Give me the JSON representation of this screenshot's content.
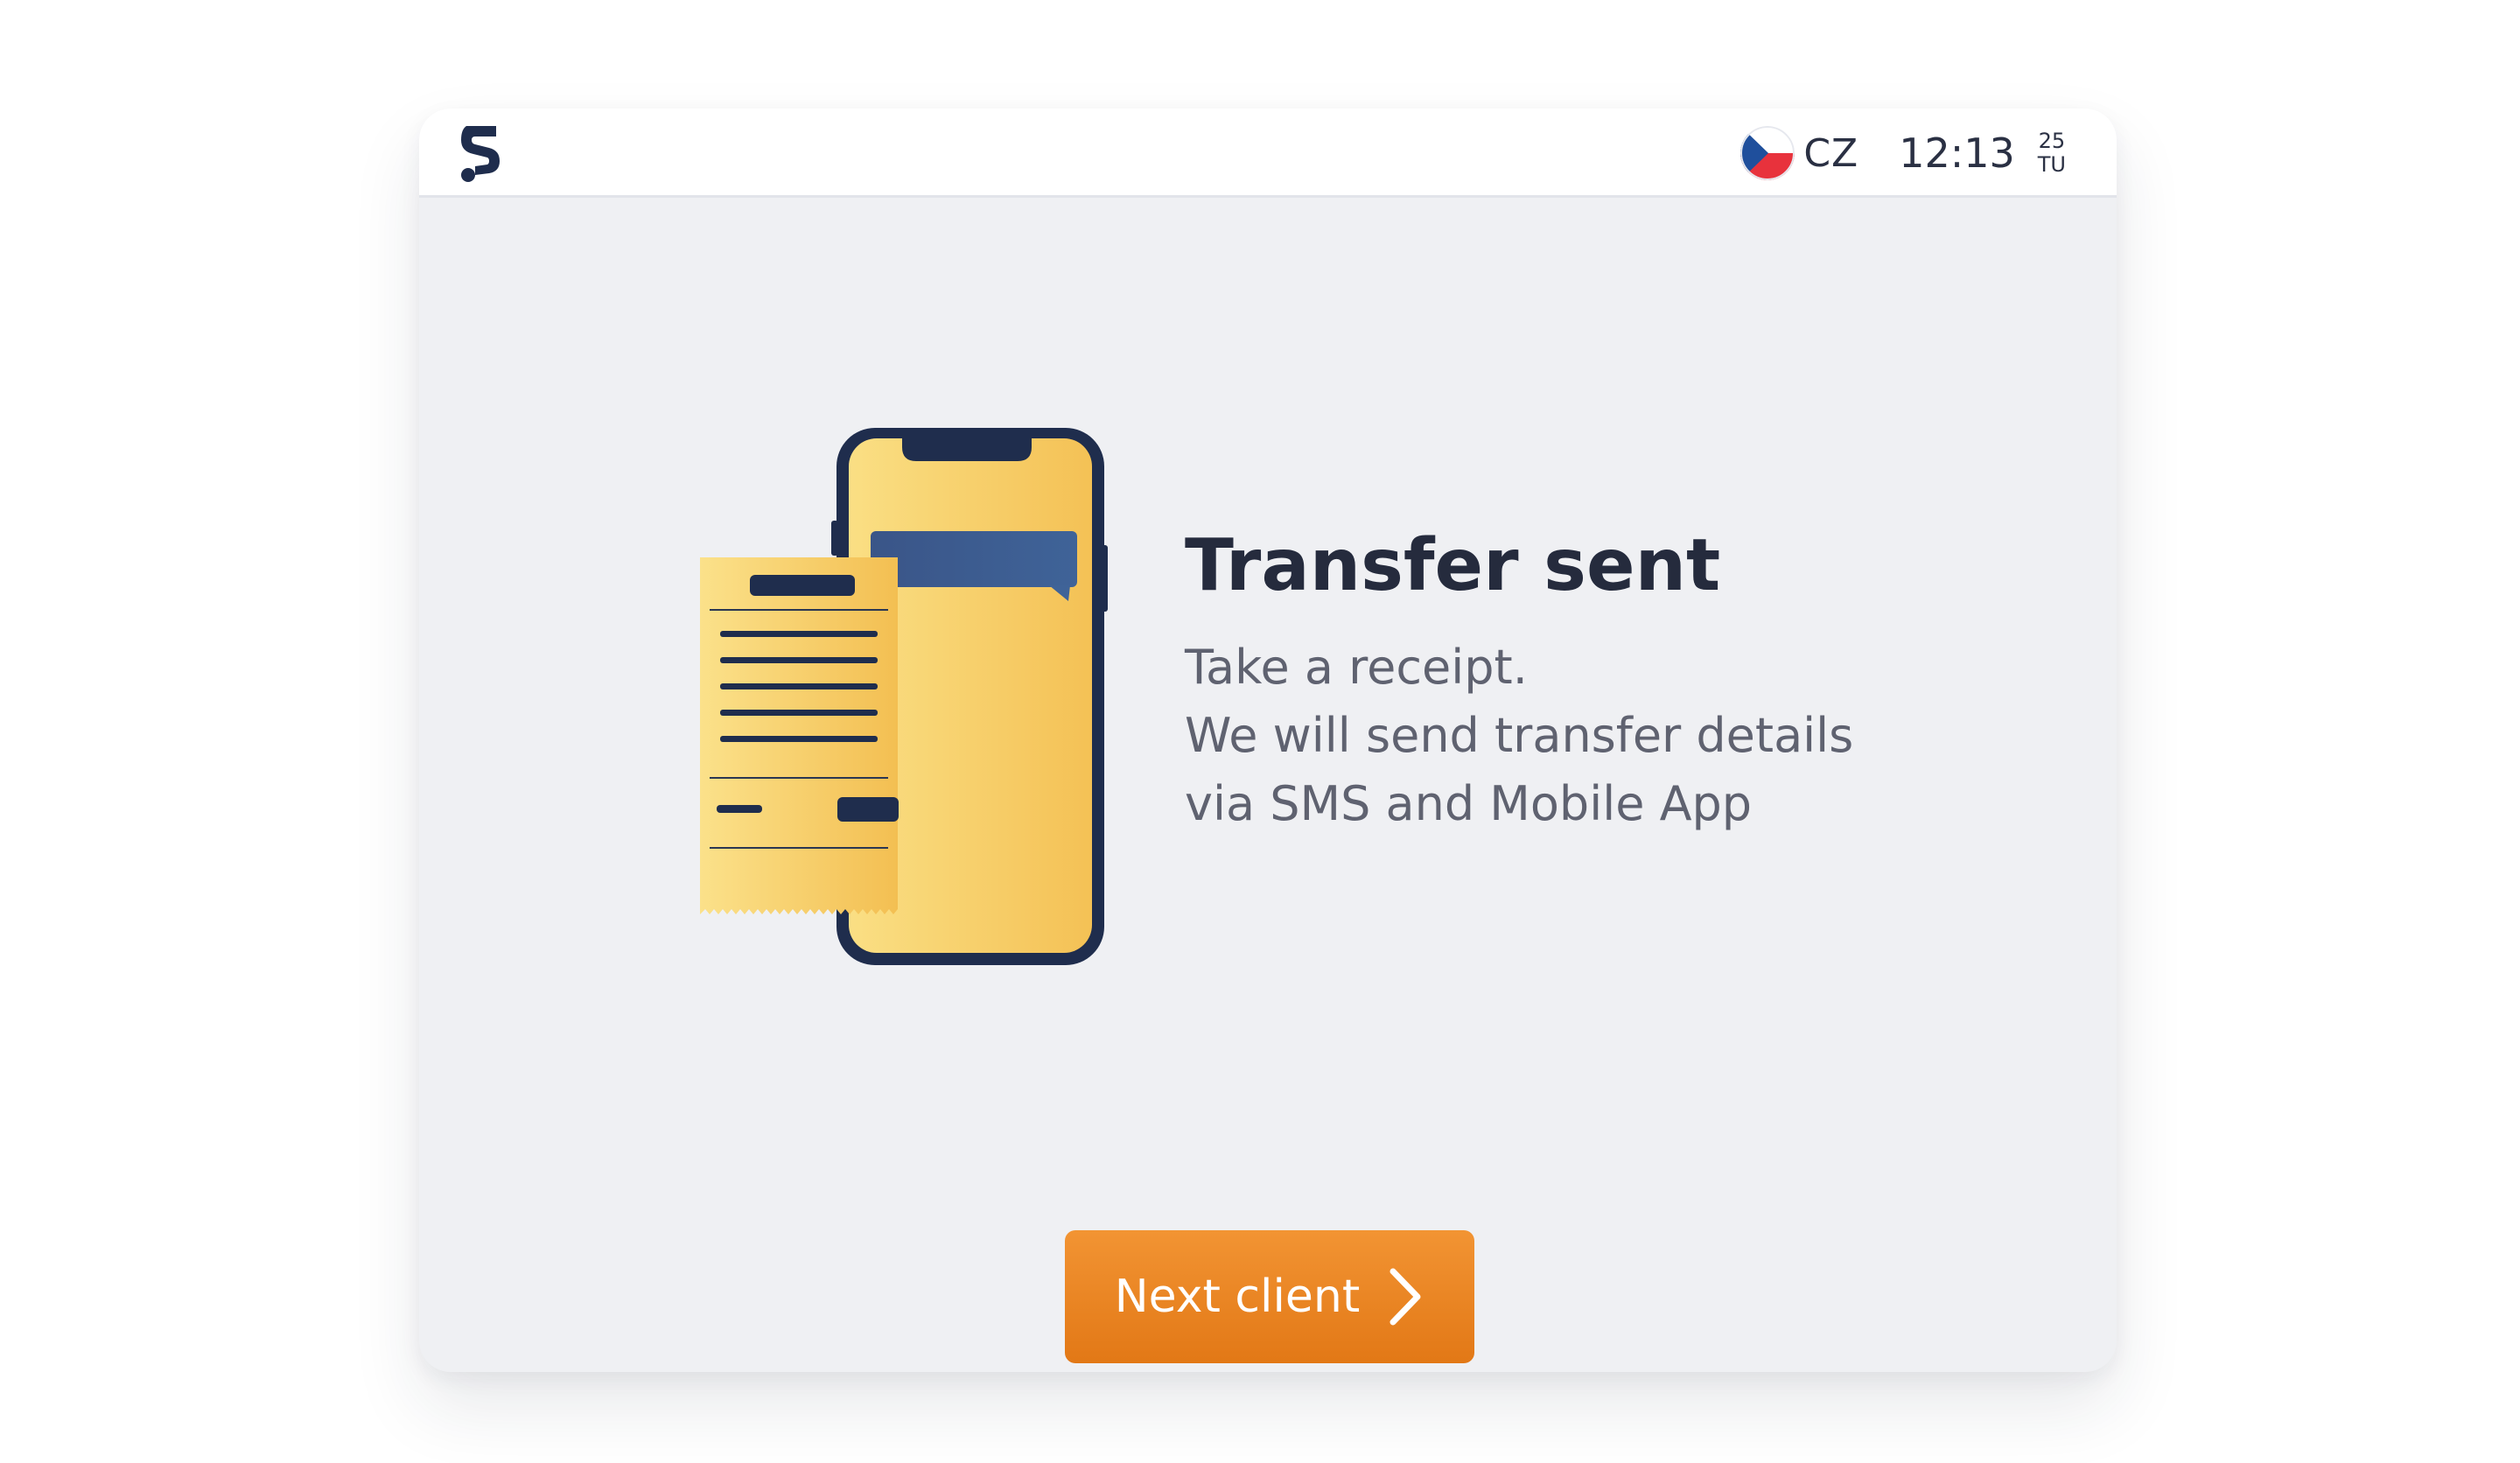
{
  "header": {
    "language": "CZ",
    "time": "12:13",
    "date_day": "25",
    "date_weekday": "TU"
  },
  "main": {
    "title": "Transfer sent",
    "message_lines": [
      "Take a receipt.",
      "We will send transfer details",
      "via SMS and Mobile App"
    ]
  },
  "footer": {
    "next_label": "Next client"
  },
  "icons": {
    "logo": "brand-s-logo",
    "flag": "czech-flag",
    "illustration": "phone-with-receipt",
    "next": "chevron-right"
  },
  "colors": {
    "brand_navy": "#1f2d4d",
    "accent_orange": "#ee8a27",
    "background": "#eff0f3",
    "illustration_yellow": "#f6c453",
    "message_bubble": "#3b5b8e"
  }
}
